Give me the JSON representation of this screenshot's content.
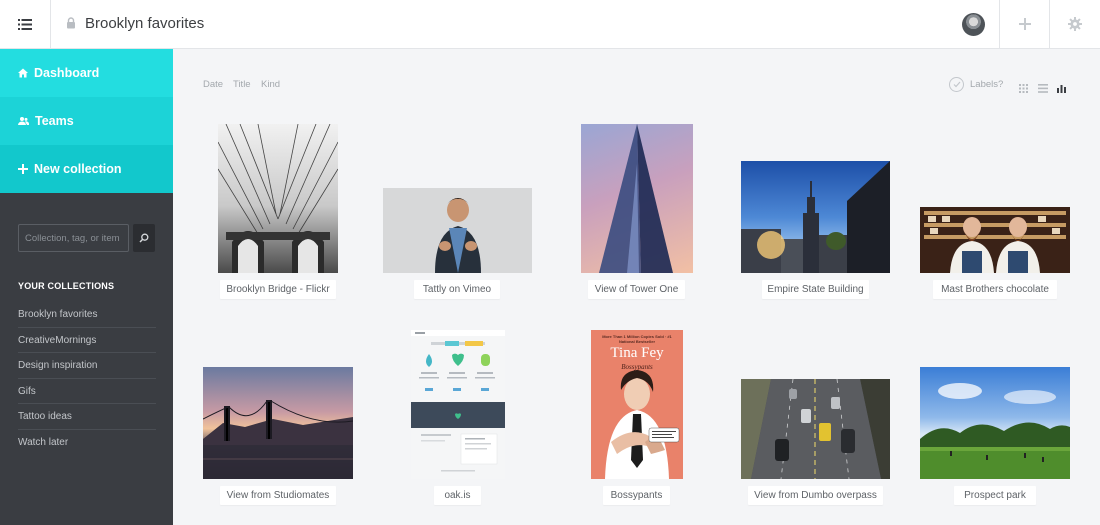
{
  "header": {
    "collection_title": "Brooklyn favorites"
  },
  "sidebar": {
    "nav": [
      {
        "label": "Dashboard",
        "icon": "home-icon"
      },
      {
        "label": "Teams",
        "icon": "team-icon"
      },
      {
        "label": "New collection",
        "icon": "plus-icon"
      }
    ],
    "search_placeholder": "Collection, tag, or item",
    "collections_heading": "YOUR COLLECTIONS",
    "collections": [
      "Brooklyn favorites",
      "CreativeMornings",
      "Design inspiration",
      "Gifs",
      "Tattoo ideas",
      "Watch later"
    ]
  },
  "toolbar": {
    "sort_options": [
      "Date",
      "Title",
      "Kind"
    ],
    "labels_toggle": "Labels?",
    "view_modes": [
      "grid-view-icon",
      "list-view-icon",
      "chart-view-icon"
    ],
    "active_view": "chart-view-icon"
  },
  "items": [
    {
      "label": "Brooklyn Bridge - Flickr"
    },
    {
      "label": "Tattly on Vimeo"
    },
    {
      "label": "View of Tower One"
    },
    {
      "label": "Empire State Building"
    },
    {
      "label": "Mast Brothers chocolate"
    },
    {
      "label": "View from Studiomates"
    },
    {
      "label": "oak.is"
    },
    {
      "label": "Bossypants",
      "book": {
        "top_line": "More Than 1 Million Copies Sold · #1 National Bestseller",
        "author": "Tina Fey",
        "title": "Bossypants"
      }
    },
    {
      "label": "View from Dumbo overpass"
    },
    {
      "label": "Prospect park"
    }
  ],
  "colors": {
    "accent": "#1cd3d7",
    "sidebar_bg": "#3a3d42",
    "content_bg": "#f4f5f7"
  }
}
